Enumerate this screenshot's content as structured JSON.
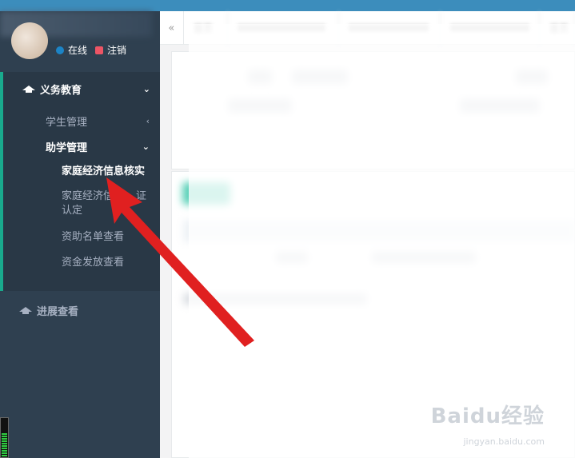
{
  "user": {
    "status": "在线",
    "logout": "注销"
  },
  "nav": {
    "compulsory": "义务教育",
    "student_mgmt": "学生管理",
    "aid_mgmt": "助学管理",
    "sub": [
      "家庭经济信息核实",
      "家庭经济信",
      "认定",
      "资助名单查看",
      "资金发放查看"
    ],
    "sub_tail": "证",
    "progress": "进展查看"
  },
  "tabs": [
    "首页",
    "",
    "",
    "",
    "首页"
  ],
  "watermark": {
    "main": "Baidu经验",
    "sub": "jingyan.baidu.com"
  },
  "colors": {
    "accent": "#3c8dbc",
    "sidebar": "#2f4050",
    "active": "#19aa8d",
    "arrow": "#e02020"
  }
}
